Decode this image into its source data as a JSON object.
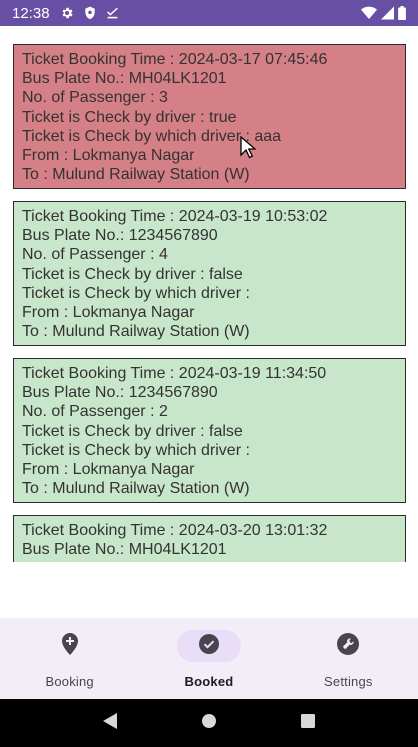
{
  "status_bar": {
    "time": "12:38",
    "left_icons": [
      "gear-icon",
      "shield-icon",
      "download-done-icon"
    ],
    "right_icons": [
      "wifi-icon",
      "signal-icon",
      "battery-icon"
    ]
  },
  "tickets": [
    {
      "status": "checked",
      "booking_time": "Ticket Booking Time : 2024-03-17 07:45:46",
      "bus_plate": "Bus Plate No.: MH04LK1201",
      "passengers": "No. of Passenger : 3",
      "checked_by_driver": "Ticket is Check by driver : true",
      "checked_by_which": "Ticket is Check by which driver : aaa",
      "from": "From : Lokmanya Nagar",
      "to": "To : Mulund Railway Station (W)"
    },
    {
      "status": "unchecked",
      "booking_time": "Ticket Booking Time : 2024-03-19 10:53:02",
      "bus_plate": "Bus Plate No.: 1234567890",
      "passengers": "No. of Passenger : 4",
      "checked_by_driver": "Ticket is Check by driver : false",
      "checked_by_which": "Ticket is Check by which driver :",
      "from": "From : Lokmanya Nagar",
      "to": "To : Mulund Railway Station (W)"
    },
    {
      "status": "unchecked",
      "booking_time": "Ticket Booking Time : 2024-03-19 11:34:50",
      "bus_plate": "Bus Plate No.: 1234567890",
      "passengers": "No. of Passenger : 2",
      "checked_by_driver": "Ticket is Check by driver : false",
      "checked_by_which": "Ticket is Check by which driver :",
      "from": "From : Lokmanya Nagar",
      "to": "To : Mulund Railway Station (W)"
    },
    {
      "status": "unchecked",
      "booking_time": "Ticket Booking Time : 2024-03-20 13:01:32",
      "bus_plate": "Bus Plate No.: MH04LK1201"
    }
  ],
  "bottom_nav": {
    "items": [
      {
        "label": "Booking",
        "icon": "location-pin-add-icon",
        "active": false
      },
      {
        "label": "Booked",
        "icon": "check-circle-icon",
        "active": true
      },
      {
        "label": "Settings",
        "icon": "wrench-settings-icon",
        "active": false
      }
    ]
  },
  "system_nav": [
    "back-icon",
    "home-icon",
    "recents-icon"
  ],
  "colors": {
    "status_bar": "#6750a4",
    "checked_ticket": "#d57f86",
    "unchecked_ticket": "#c8e6c9",
    "nav_background": "#f3edf7",
    "active_pill": "#e8def8"
  }
}
